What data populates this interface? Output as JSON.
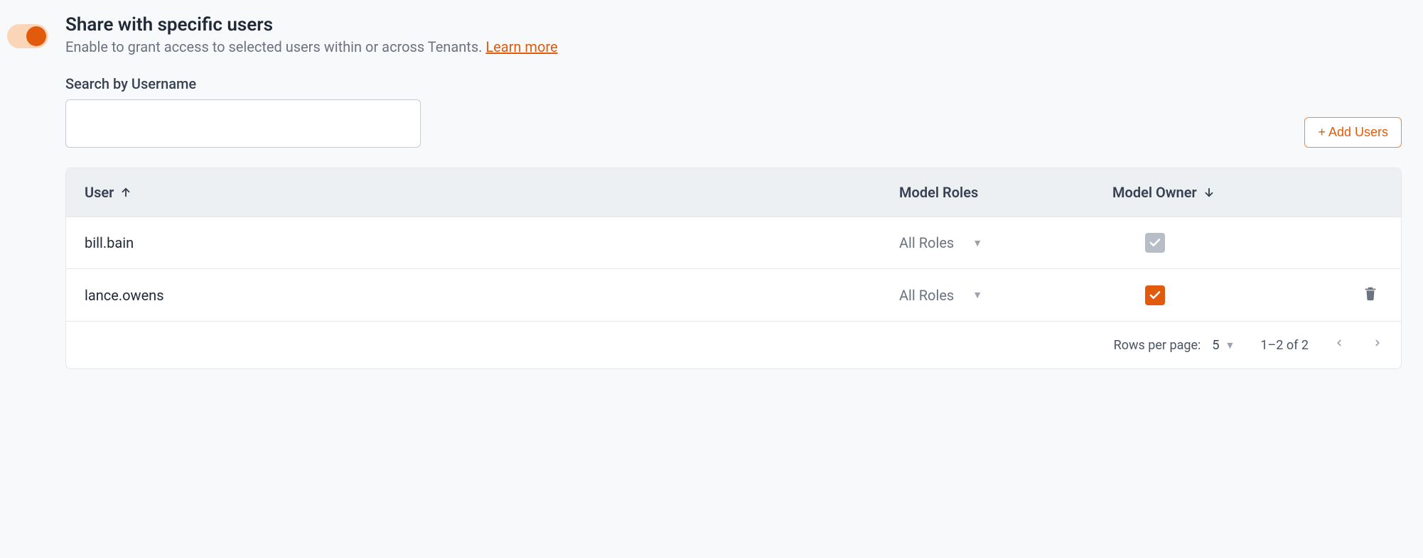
{
  "header": {
    "title": "Share with specific users",
    "subtitle_prefix": "Enable to grant access to selected users within or across Tenants.",
    "learn_more": "Learn more"
  },
  "search": {
    "label": "Search by Username",
    "value": ""
  },
  "actions": {
    "add_users": "+ Add Users"
  },
  "table": {
    "columns": {
      "user": "User",
      "roles": "Model Roles",
      "owner": "Model Owner"
    },
    "rows": [
      {
        "user": "bill.bain",
        "roles": "All Roles",
        "owner_checked": true,
        "owner_color": "gray",
        "deletable": false
      },
      {
        "user": "lance.owens",
        "roles": "All Roles",
        "owner_checked": true,
        "owner_color": "orange",
        "deletable": true
      }
    ]
  },
  "pagination": {
    "rows_per_page_label": "Rows per page:",
    "rows_per_page_value": "5",
    "range": "1–2 of 2"
  }
}
